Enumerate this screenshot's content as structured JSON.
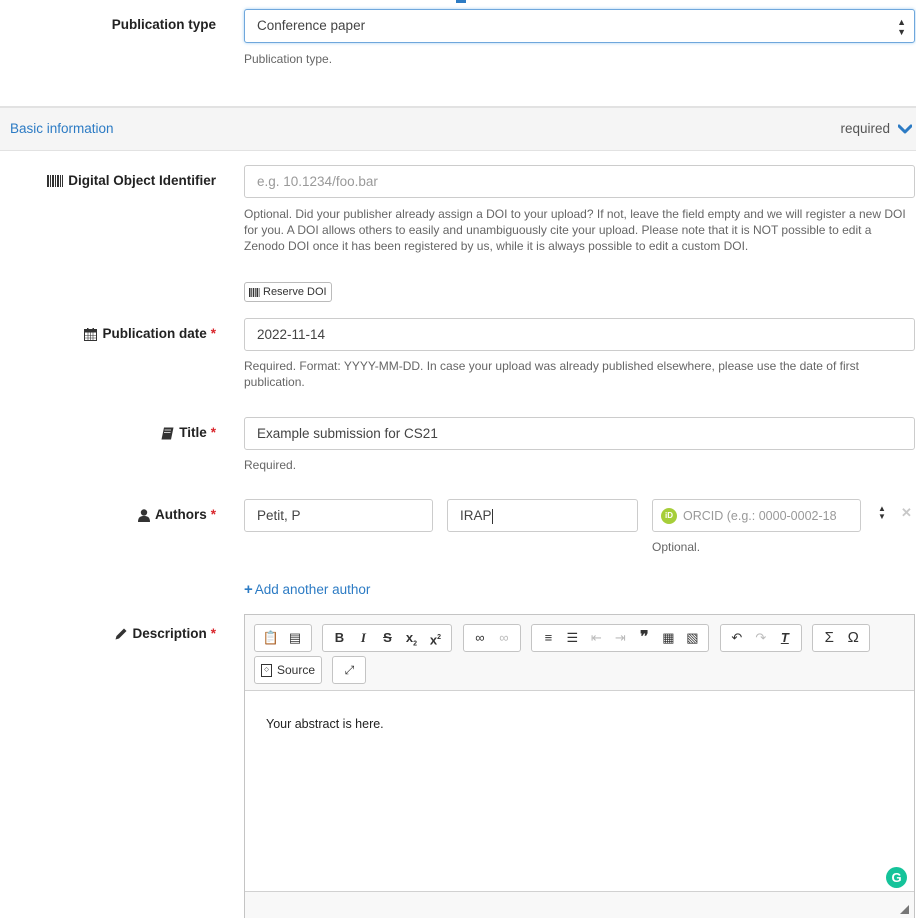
{
  "publication_type": {
    "label": "Publication type",
    "value": "Conference paper",
    "help": "Publication type."
  },
  "section": {
    "title": "Basic information",
    "status": "required"
  },
  "doi": {
    "label": "Digital Object Identifier",
    "placeholder": "e.g. 10.1234/foo.bar",
    "help": "Optional. Did your publisher already assign a DOI to your upload? If not, leave the field empty and we will register a new DOI for you. A DOI allows others to easily and unambiguously cite your upload. Please note that it is NOT possible to edit a Zenodo DOI once it has been registered by us, while it is always possible to edit a custom DOI.",
    "reserve_button": "Reserve DOI"
  },
  "publication_date": {
    "label": "Publication date",
    "required_mark": "*",
    "value": "2022-11-14",
    "help": "Required. Format: YYYY-MM-DD. In case your upload was already published elsewhere, please use the date of first publication."
  },
  "title": {
    "label": "Title",
    "required_mark": "*",
    "value": "Example submission for CS21",
    "help": "Required."
  },
  "authors": {
    "label": "Authors",
    "required_mark": "*",
    "name": "Petit, P",
    "affiliation": "IRAP",
    "orcid_placeholder": "ORCID (e.g.: 0000-0002-18",
    "orcid_badge": "iD",
    "orcid_help": "Optional.",
    "add_link": "Add another author"
  },
  "description": {
    "label": "Description",
    "required_mark": "*",
    "source_button": "Source",
    "body": "Your abstract is here.",
    "grammarly_badge": "G"
  },
  "colors": {
    "accent": "#2c7bc4",
    "required": "#d9262c",
    "orcid": "#a6ce39",
    "grammarly": "#15c39a"
  }
}
